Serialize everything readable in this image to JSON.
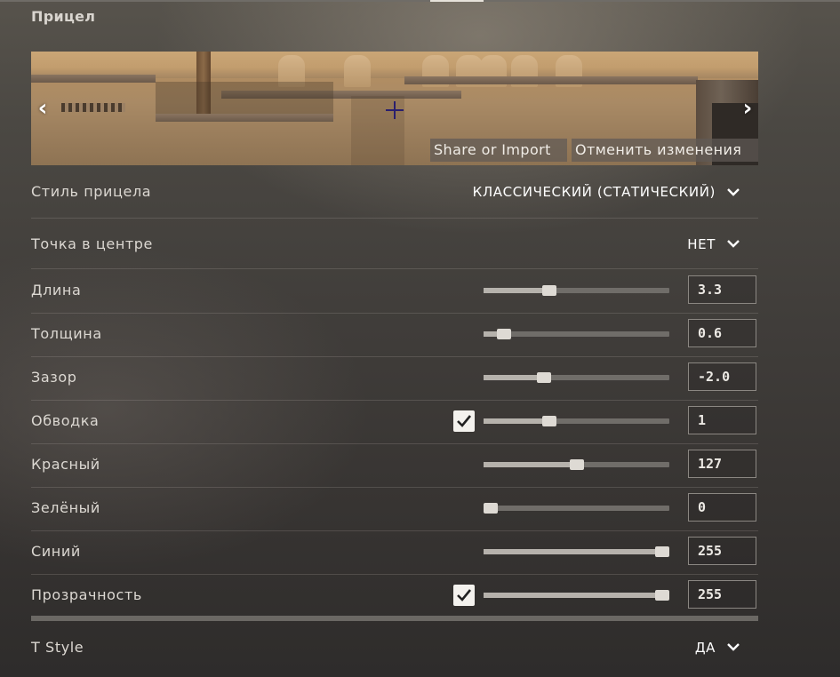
{
  "section": {
    "title": "Прицел"
  },
  "preview": {
    "share_label": "Share or Import",
    "revert_label": "Отменить изменения",
    "prev_icon": "chevron-left-icon",
    "next_icon": "chevron-right-icon"
  },
  "dropdowns": {
    "style": {
      "label": "Стиль прицела",
      "value": "КЛАССИЧЕСКИЙ (СТАТИЧЕСКИЙ)"
    },
    "center_dot": {
      "label": "Точка в центре",
      "value": "НЕТ"
    },
    "t_style": {
      "label": "T Style",
      "value": "ДА"
    }
  },
  "sliders": [
    {
      "label": "Длина",
      "value": "3.3",
      "level": 0.34,
      "checkbox": false
    },
    {
      "label": "Толщина",
      "value": "0.6",
      "level": 0.08,
      "checkbox": false
    },
    {
      "label": "Зазор",
      "value": "-2.0",
      "level": 0.31,
      "checkbox": false
    },
    {
      "label": "Обводка",
      "value": "1",
      "level": 0.34,
      "checkbox": true,
      "checked": true
    },
    {
      "label": "Красный",
      "value": "127",
      "level": 0.5,
      "checkbox": false
    },
    {
      "label": "Зелёный",
      "value": "0",
      "level": 0.0,
      "checkbox": false
    },
    {
      "label": "Синий",
      "value": "255",
      "level": 1.0,
      "checkbox": false
    },
    {
      "label": "Прозрачность",
      "value": "255",
      "level": 1.0,
      "checkbox": true,
      "checked": true
    }
  ],
  "colors": {
    "text": "#e9e6e1",
    "slider_track": "#706d69",
    "slider_fill": "#b6b2ac",
    "thumb": "#dedad4",
    "crosshair": "#2a1f6e"
  }
}
